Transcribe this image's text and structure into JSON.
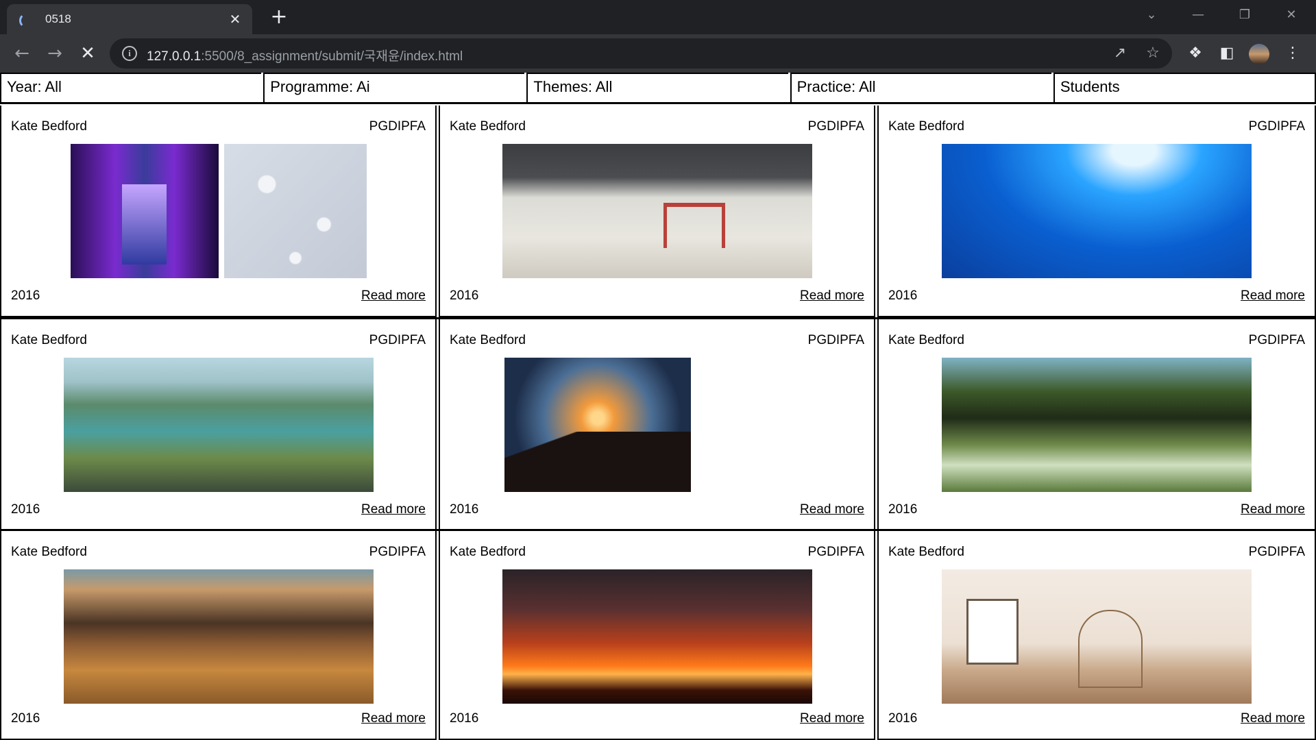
{
  "browser": {
    "tab_title": "0518",
    "tab_close": "✕",
    "new_tab": "+",
    "url_host": "127.0.0.1",
    "url_path": ":5500/8_assignment/submit/국재윤/index.html",
    "win_chevron": "⌄",
    "win_min": "—",
    "win_restore": "❐",
    "win_close": "✕"
  },
  "filters": [
    "Year: All",
    "Programme: Ai",
    "Themes: All",
    "Practice: All",
    "Students"
  ],
  "cards": [
    {
      "name": "Kate Bedford",
      "programme": "PGDIPFA",
      "year": "2016",
      "link": "Read more"
    },
    {
      "name": "Kate Bedford",
      "programme": "PGDIPFA",
      "year": "2016",
      "link": "Read more"
    },
    {
      "name": "Kate Bedford",
      "programme": "PGDIPFA",
      "year": "2016",
      "link": "Read more"
    },
    {
      "name": "Kate Bedford",
      "programme": "PGDIPFA",
      "year": "2016",
      "link": "Read more"
    },
    {
      "name": "Kate Bedford",
      "programme": "PGDIPFA",
      "year": "2016",
      "link": "Read more"
    },
    {
      "name": "Kate Bedford",
      "programme": "PGDIPFA",
      "year": "2016",
      "link": "Read more"
    },
    {
      "name": "Kate Bedford",
      "programme": "PGDIPFA",
      "year": "2016",
      "link": "Read more"
    },
    {
      "name": "Kate Bedford",
      "programme": "PGDIPFA",
      "year": "2016",
      "link": "Read more"
    },
    {
      "name": "Kate Bedford",
      "programme": "PGDIPFA",
      "year": "2016",
      "link": "Read more"
    }
  ],
  "accent": "#8ab4f8",
  "chrome_bg": "#202124",
  "toolbar_bg": "#35363a"
}
